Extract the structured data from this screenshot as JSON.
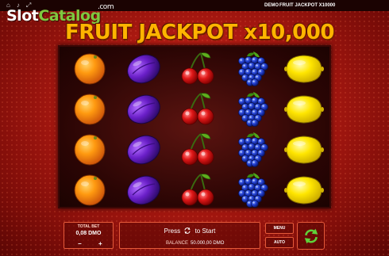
{
  "topbar": {
    "demo_label": "DEMO",
    "game_name": "FRUIT JACKPOT X10000"
  },
  "logo": {
    "part1": "Slot",
    "part2": "Catalog",
    "suffix": ".com"
  },
  "title": "FRUIT JACKPOT x10,000",
  "reels": [
    {
      "symbol": "orange",
      "rows": [
        "orange",
        "orange",
        "orange",
        "orange"
      ]
    },
    {
      "symbol": "plum",
      "rows": [
        "plum",
        "plum",
        "plum",
        "plum"
      ]
    },
    {
      "symbol": "cherry",
      "rows": [
        "cherry",
        "cherry",
        "cherry",
        "cherry"
      ]
    },
    {
      "symbol": "grapes",
      "rows": [
        "grapes",
        "grapes",
        "grapes",
        "grapes"
      ]
    },
    {
      "symbol": "lemon",
      "rows": [
        "lemon",
        "lemon",
        "lemon",
        "lemon"
      ]
    }
  ],
  "controls": {
    "total_bet_label": "TOTAL BET",
    "total_bet_value": "0,08 DMO",
    "minus": "−",
    "plus": "+",
    "press_label": "Press",
    "to_start_label": "to Start",
    "balance_label": "BALANCE",
    "balance_value": "50.000,00 DMO",
    "menu_label": "MENU",
    "auto_label": "AUTO"
  },
  "colors": {
    "accent": "#e55a3a",
    "title": "#ffb400",
    "spin": "#5fd13a"
  }
}
